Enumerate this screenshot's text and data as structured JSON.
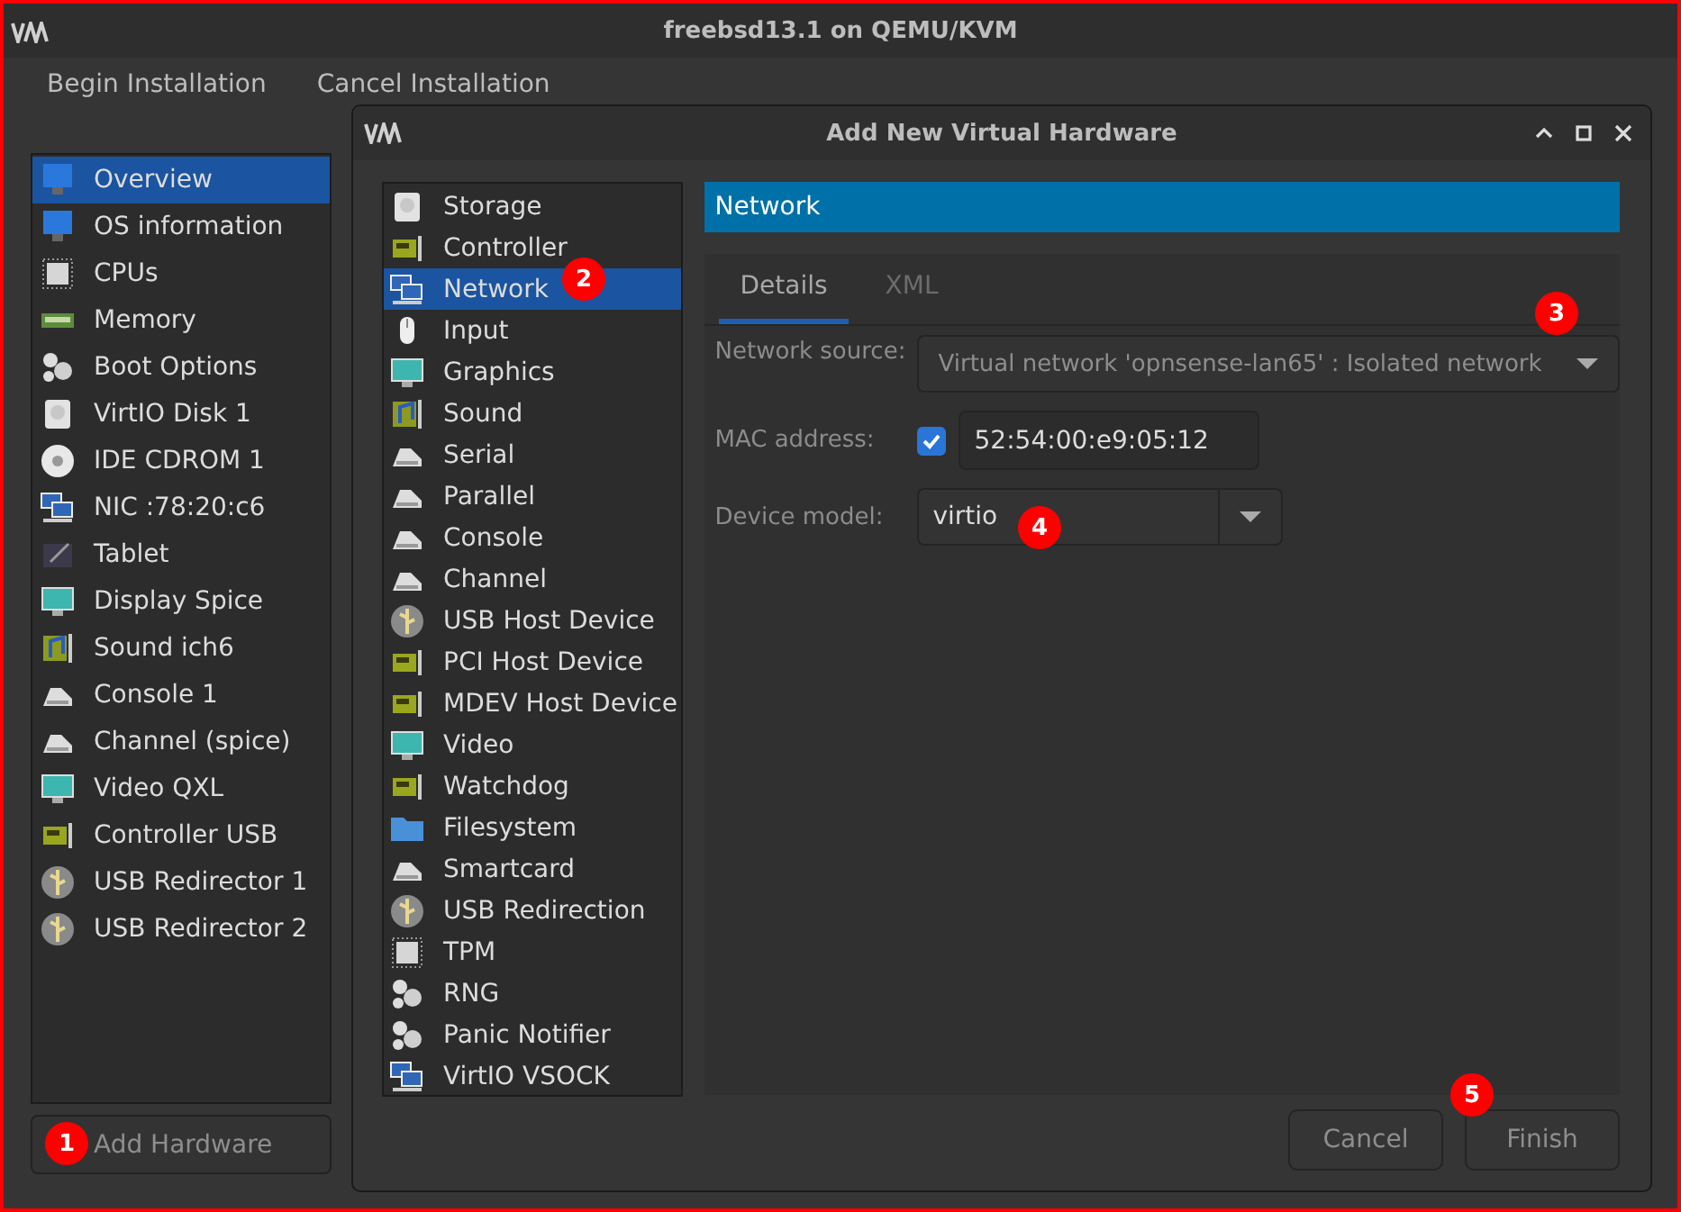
{
  "window": {
    "title": "freebsd13.1 on QEMU/KVM"
  },
  "toolbar": [
    "Begin Installation",
    "Cancel Installation"
  ],
  "sidebar": {
    "items": [
      {
        "label": "Overview",
        "selected": true
      },
      {
        "label": "OS information",
        "selected": false
      },
      {
        "label": "CPUs",
        "selected": false
      },
      {
        "label": "Memory",
        "selected": false
      },
      {
        "label": "Boot Options",
        "selected": false
      },
      {
        "label": "VirtIO Disk 1",
        "selected": false
      },
      {
        "label": "IDE CDROM 1",
        "selected": false
      },
      {
        "label": "NIC :78:20:c6",
        "selected": false
      },
      {
        "label": "Tablet",
        "selected": false
      },
      {
        "label": "Display Spice",
        "selected": false
      },
      {
        "label": "Sound ich6",
        "selected": false
      },
      {
        "label": "Console 1",
        "selected": false
      },
      {
        "label": "Channel (spice)",
        "selected": false
      },
      {
        "label": "Video QXL",
        "selected": false
      },
      {
        "label": "Controller USB",
        "selected": false
      },
      {
        "label": "USB Redirector 1",
        "selected": false
      },
      {
        "label": "USB Redirector 2",
        "selected": false
      }
    ]
  },
  "add_hardware_button": "Add Hardware",
  "dialog": {
    "title": "Add New Virtual Hardware",
    "hardware_types": [
      {
        "label": "Storage",
        "selected": false
      },
      {
        "label": "Controller",
        "selected": false
      },
      {
        "label": "Network",
        "selected": true
      },
      {
        "label": "Input",
        "selected": false
      },
      {
        "label": "Graphics",
        "selected": false
      },
      {
        "label": "Sound",
        "selected": false
      },
      {
        "label": "Serial",
        "selected": false
      },
      {
        "label": "Parallel",
        "selected": false
      },
      {
        "label": "Console",
        "selected": false
      },
      {
        "label": "Channel",
        "selected": false
      },
      {
        "label": "USB Host Device",
        "selected": false
      },
      {
        "label": "PCI Host Device",
        "selected": false
      },
      {
        "label": "MDEV Host Device",
        "selected": false
      },
      {
        "label": "Video",
        "selected": false
      },
      {
        "label": "Watchdog",
        "selected": false
      },
      {
        "label": "Filesystem",
        "selected": false
      },
      {
        "label": "Smartcard",
        "selected": false
      },
      {
        "label": "USB Redirection",
        "selected": false
      },
      {
        "label": "TPM",
        "selected": false
      },
      {
        "label": "RNG",
        "selected": false
      },
      {
        "label": "Panic Notifier",
        "selected": false
      },
      {
        "label": "VirtIO VSOCK",
        "selected": false
      }
    ],
    "section_title": "Network",
    "tabs": [
      {
        "label": "Details",
        "selected": true
      },
      {
        "label": "XML",
        "selected": false
      }
    ],
    "network_source": {
      "label": "Network source:",
      "value": "Virtual network 'opnsense-lan65' : Isolated network"
    },
    "mac_address": {
      "label": "MAC address:",
      "checked": true,
      "value": "52:54:00:e9:05:12"
    },
    "device_model": {
      "label": "Device model:",
      "value": "virtio"
    },
    "buttons": [
      "Cancel",
      "Finish"
    ]
  },
  "annotations": [
    "1",
    "2",
    "3",
    "4",
    "5"
  ]
}
